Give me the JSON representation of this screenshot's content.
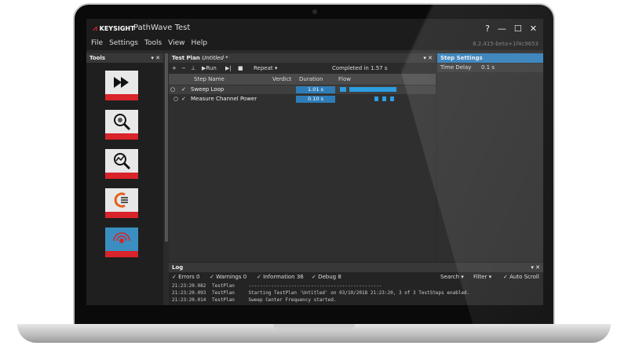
{
  "app": {
    "brand": "KEYSIGHT",
    "title": "PathWave Test",
    "version": "8.2.415-beta+1f4c9653",
    "window_buttons": [
      "?",
      "—",
      "☐",
      "✕"
    ]
  },
  "menu": [
    "File",
    "Settings",
    "Tools",
    "View",
    "Help"
  ],
  "tools_panel": {
    "title": "Tools",
    "items": [
      "run-tool",
      "dut-inspect-tool",
      "analysis-tool",
      "keysight-tool",
      "signal-tool"
    ]
  },
  "test_plan": {
    "title": "Test Plan",
    "name": "Untitled *",
    "toolbar": {
      "run": "Run",
      "repeat": "Repeat",
      "status": "Completed in 1.57 s"
    },
    "columns": {
      "step_name": "Step Name",
      "verdict": "Verdict",
      "duration": "Duration",
      "flow": "Flow"
    },
    "steps": [
      {
        "name": "Sweep Loop",
        "duration": "1.01 s",
        "checked": "✓"
      },
      {
        "name": "Measure Channel Power",
        "duration": "0.10 s",
        "checked": "✓"
      }
    ]
  },
  "step_settings": {
    "title": "Step Settings",
    "row_label": "Time Delay",
    "row_value": "0.1 s"
  },
  "log": {
    "title": "Log",
    "filters": {
      "errors": "Errors 0",
      "warnings": "Warnings 0",
      "information": "Information 36",
      "debug": "Debug 8",
      "search": "Search",
      "filter": "Filter",
      "autoscroll": "Auto Scroll"
    },
    "lines": [
      {
        "time": "21:23:20.082",
        "source": "TestPlan",
        "message": "-----------------------------------------------"
      },
      {
        "time": "21:23:20.093",
        "source": "TestPlan",
        "message": "Starting TestPlan 'Untitled' on 03/10/2018 21:23:20, 3 of 3 TestSteps enabled."
      },
      {
        "time": "21:23:20.014",
        "source": "TestPlan",
        "message": "Sweep Center Frequency started."
      }
    ]
  },
  "colors": {
    "accent": "#d8242a",
    "selection": "#2f7db8",
    "flow": "#2e9de0"
  }
}
